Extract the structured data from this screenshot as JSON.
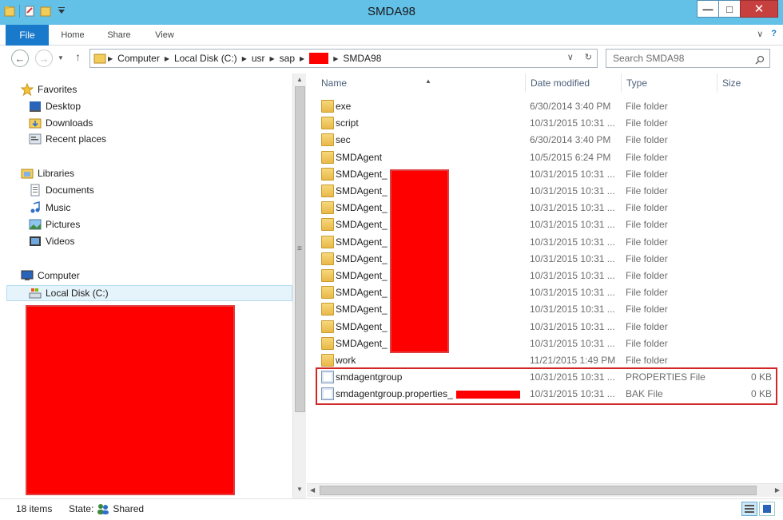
{
  "window": {
    "title": "SMDA98"
  },
  "ribbon": {
    "tabs": [
      {
        "label": "File"
      },
      {
        "label": "Home"
      },
      {
        "label": "Share"
      },
      {
        "label": "View"
      }
    ]
  },
  "address": {
    "crumbs": [
      "Computer",
      "Local Disk (C:)",
      "usr",
      "sap",
      "SMDA98"
    ]
  },
  "search": {
    "placeholder": "Search SMDA98"
  },
  "nav": {
    "favorites": "Favorites",
    "desktop": "Desktop",
    "downloads": "Downloads",
    "recent": "Recent places",
    "libraries": "Libraries",
    "documents": "Documents",
    "music": "Music",
    "pictures": "Pictures",
    "videos": "Videos",
    "computer": "Computer",
    "local_disk": "Local Disk (C:)"
  },
  "columns": {
    "name": "Name",
    "date": "Date modified",
    "type": "Type",
    "size": "Size"
  },
  "rows": [
    {
      "name": "exe",
      "date": "6/30/2014 3:40 PM",
      "type": "File folder",
      "size": "",
      "icon": "folder"
    },
    {
      "name": "script",
      "date": "10/31/2015 10:31 ...",
      "type": "File folder",
      "size": "",
      "icon": "folder"
    },
    {
      "name": "sec",
      "date": "6/30/2014 3:40 PM",
      "type": "File folder",
      "size": "",
      "icon": "folder"
    },
    {
      "name": "SMDAgent",
      "date": "10/5/2015 6:24 PM",
      "type": "File folder",
      "size": "",
      "icon": "folder"
    },
    {
      "name": "SMDAgent_",
      "date": "10/31/2015 10:31 ...",
      "type": "File folder",
      "size": "",
      "icon": "folder"
    },
    {
      "name": "SMDAgent_",
      "date": "10/31/2015 10:31 ...",
      "type": "File folder",
      "size": "",
      "icon": "folder"
    },
    {
      "name": "SMDAgent_",
      "date": "10/31/2015 10:31 ...",
      "type": "File folder",
      "size": "",
      "icon": "folder"
    },
    {
      "name": "SMDAgent_",
      "date": "10/31/2015 10:31 ...",
      "type": "File folder",
      "size": "",
      "icon": "folder"
    },
    {
      "name": "SMDAgent_",
      "date": "10/31/2015 10:31 ...",
      "type": "File folder",
      "size": "",
      "icon": "folder"
    },
    {
      "name": "SMDAgent_",
      "date": "10/31/2015 10:31 ...",
      "type": "File folder",
      "size": "",
      "icon": "folder"
    },
    {
      "name": "SMDAgent_",
      "date": "10/31/2015 10:31 ...",
      "type": "File folder",
      "size": "",
      "icon": "folder"
    },
    {
      "name": "SMDAgent_",
      "date": "10/31/2015 10:31 ...",
      "type": "File folder",
      "size": "",
      "icon": "folder"
    },
    {
      "name": "SMDAgent_",
      "date": "10/31/2015 10:31 ...",
      "type": "File folder",
      "size": "",
      "icon": "folder"
    },
    {
      "name": "SMDAgent_",
      "date": "10/31/2015 10:31 ...",
      "type": "File folder",
      "size": "",
      "icon": "folder"
    },
    {
      "name": "SMDAgent_",
      "date": "10/31/2015 10:31 ...",
      "type": "File folder",
      "size": "",
      "icon": "folder"
    },
    {
      "name": "work",
      "date": "11/21/2015 1:49 PM",
      "type": "File folder",
      "size": "",
      "icon": "folder"
    },
    {
      "name": "smdagentgroup",
      "date": "10/31/2015 10:31 ...",
      "type": "PROPERTIES File",
      "size": "0 KB",
      "icon": "file"
    },
    {
      "name": "smdagentgroup.properties_",
      "date": "10/31/2015 10:31 ...",
      "type": "BAK File",
      "size": "0 KB",
      "icon": "file"
    }
  ],
  "status": {
    "count": "18 items",
    "state_label": "State:",
    "state_value": "Shared"
  },
  "colors": {
    "titlebar": "#63c0e7",
    "file_tab": "#1979ca",
    "redaction": "#ff0000",
    "highlight": "#d32626"
  }
}
